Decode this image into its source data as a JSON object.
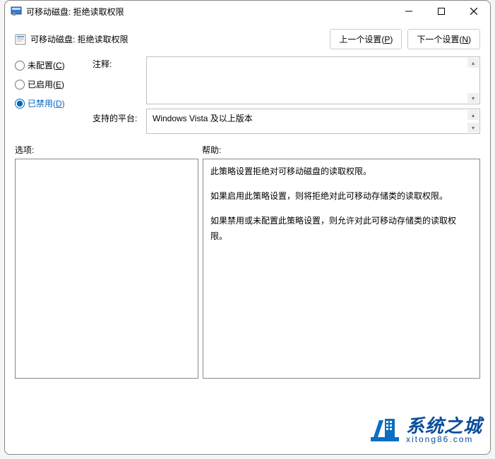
{
  "window": {
    "title": "可移动磁盘: 拒绝读取权限"
  },
  "header": {
    "policy_title": "可移动磁盘: 拒绝读取权限",
    "prev_label": "上一个设置(",
    "prev_key": "P",
    "prev_close": ")",
    "next_label": "下一个设置(",
    "next_key": "N",
    "next_close": ")"
  },
  "radios": {
    "not_configured": "未配置(",
    "not_configured_key": "C",
    "enabled": "已启用(",
    "enabled_key": "E",
    "disabled": "已禁用(",
    "disabled_key": "D",
    "close": ")",
    "selected": "disabled"
  },
  "labels": {
    "comment": "注释:",
    "platform": "支持的平台:",
    "options": "选项:",
    "help": "帮助:"
  },
  "fields": {
    "comment_value": "",
    "platform_value": "Windows Vista 及以上版本"
  },
  "help": {
    "p1": "此策略设置拒绝对可移动磁盘的读取权限。",
    "p2": "如果启用此策略设置，则将拒绝对此可移动存储类的读取权限。",
    "p3": "如果禁用或未配置此策略设置，则允许对此可移动存储类的读取权限。"
  },
  "watermark": {
    "title": "系统之城",
    "url": "xitong86.com"
  }
}
